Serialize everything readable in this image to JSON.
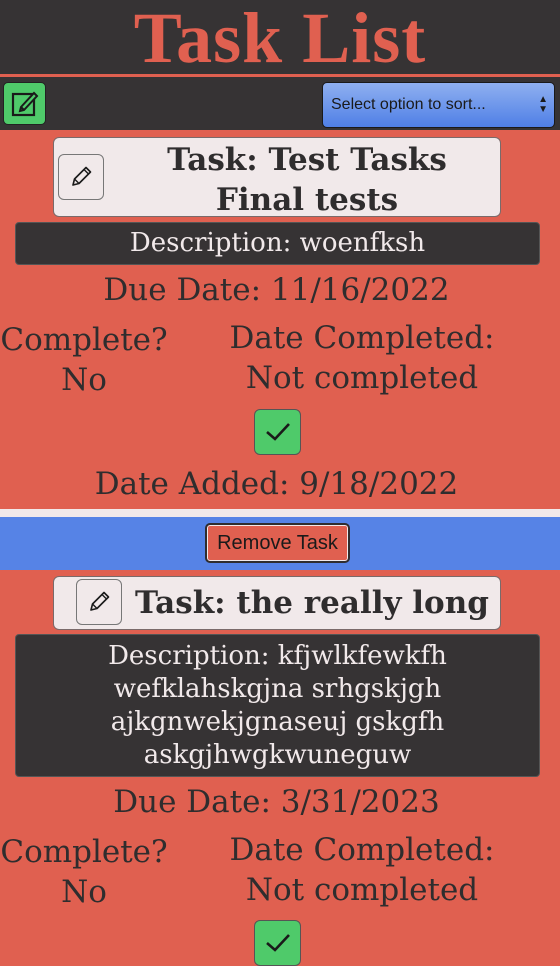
{
  "header": {
    "title": "Task List"
  },
  "toolbar": {
    "sort_placeholder": "Select option to sort..."
  },
  "tasks": [
    {
      "title": "Task: Test Tasks Final tests",
      "description": "Description: woenfksh",
      "due_date": "Due Date: 11/16/2022",
      "complete_label": "Complete?",
      "complete_value": "No",
      "date_completed": "Date Completed: Not completed",
      "date_added": "Date Added: 9/18/2022"
    },
    {
      "title": "Task: the really long test",
      "description": "Description: kfjwlkfewkfhwefklahskgjna srhgskjghajkgnwekjgnaseuj gskgfhaskgjhwgkwuneguw",
      "due_date": "Due Date: 3/31/2023",
      "complete_label": "Complete?",
      "complete_value": "No",
      "date_completed": "Date Completed: Not completed"
    }
  ],
  "actions": {
    "remove_task_label": "Remove Task"
  },
  "colors": {
    "accent": "#e06050",
    "dark": "#363334",
    "complete_green": "#4fca6a",
    "remove_bar_blue": "#5683e6"
  },
  "icons": [
    "add-task-icon",
    "pencil-icon",
    "checkmark-icon",
    "sort-arrows-icon"
  ]
}
